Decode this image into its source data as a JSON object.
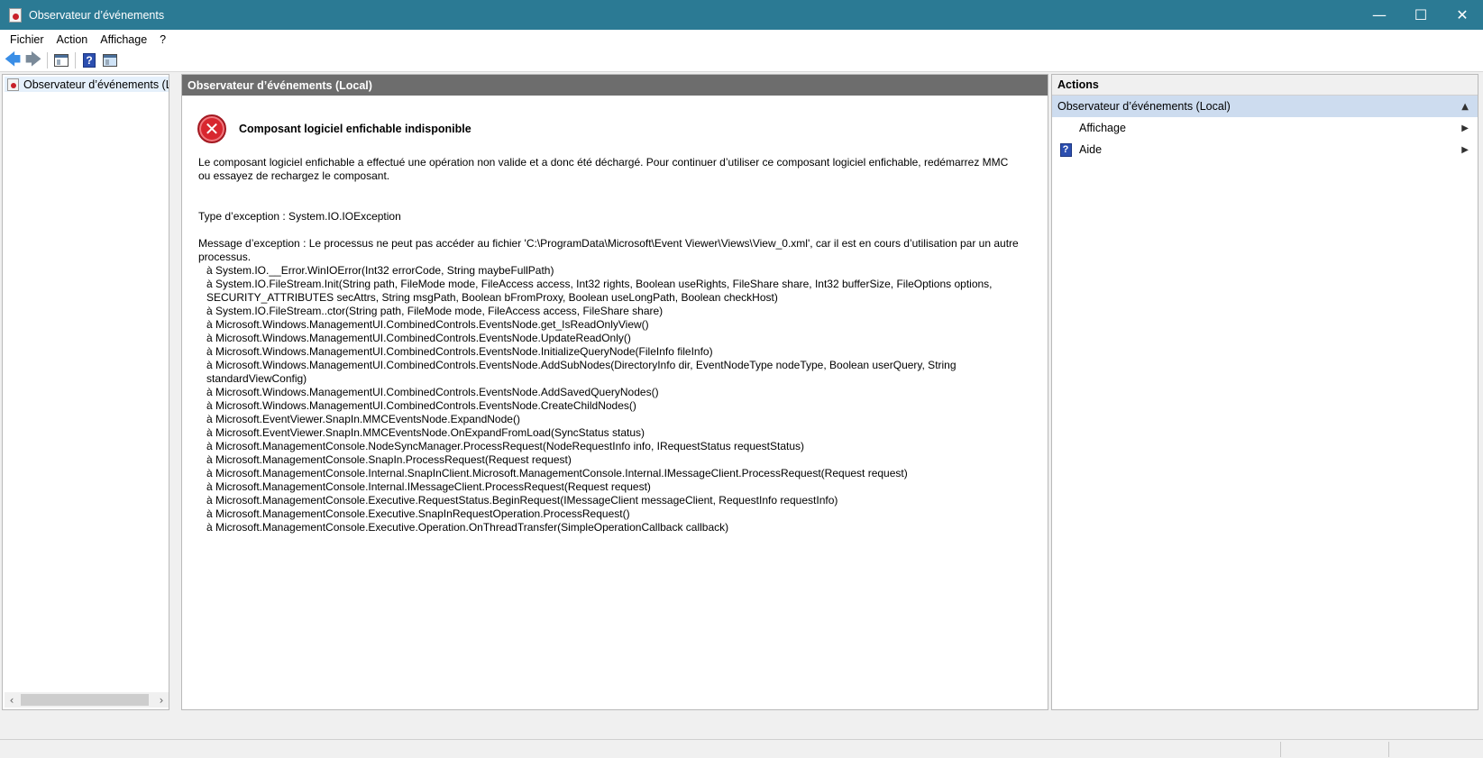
{
  "window": {
    "title": "Observateur d’événements",
    "minimize_glyph": "—",
    "maximize_glyph": "☐",
    "close_glyph": "✕"
  },
  "menu": {
    "items": [
      "Fichier",
      "Action",
      "Affichage",
      "?"
    ]
  },
  "toolbar": {
    "back_glyph": "🡄",
    "forward_glyph": "🡆",
    "help_glyph": "?"
  },
  "tree": {
    "root_label": "Observateur d’événements (Local)",
    "scroll_left": "‹",
    "scroll_right": "›"
  },
  "center": {
    "header": "Observateur d’événements (Local)",
    "error_glyph": "✕",
    "error_title": "Composant logiciel enfichable indisponible",
    "description": "Le composant logiciel enfichable a effectué une opération non valide et a donc été déchargé. Pour continuer d’utiliser ce composant logiciel enfichable, redémarrez MMC ou essayez de rechargez le composant.",
    "exception_type": "Type d’exception : System.IO.IOException",
    "exception_message": "Message d’exception : Le processus ne peut pas accéder au fichier 'C:\\ProgramData\\Microsoft\\Event Viewer\\Views\\View_0.xml', car il est en cours d’utilisation par un autre processus.",
    "stack_trace": [
      "à System.IO.__Error.WinIOError(Int32 errorCode, String maybeFullPath)",
      "à System.IO.FileStream.Init(String path, FileMode mode, FileAccess access, Int32 rights, Boolean useRights, FileShare share, Int32 bufferSize, FileOptions options, SECURITY_ATTRIBUTES secAttrs, String msgPath, Boolean bFromProxy, Boolean useLongPath, Boolean checkHost)",
      "à System.IO.FileStream..ctor(String path, FileMode mode, FileAccess access, FileShare share)",
      "à Microsoft.Windows.ManagementUI.CombinedControls.EventsNode.get_IsReadOnlyView()",
      "à Microsoft.Windows.ManagementUI.CombinedControls.EventsNode.UpdateReadOnly()",
      "à Microsoft.Windows.ManagementUI.CombinedControls.EventsNode.InitializeQueryNode(FileInfo fileInfo)",
      "à Microsoft.Windows.ManagementUI.CombinedControls.EventsNode.AddSubNodes(DirectoryInfo dir, EventNodeType nodeType, Boolean userQuery, String standardViewConfig)",
      "à Microsoft.Windows.ManagementUI.CombinedControls.EventsNode.AddSavedQueryNodes()",
      "à Microsoft.Windows.ManagementUI.CombinedControls.EventsNode.CreateChildNodes()",
      "à Microsoft.EventViewer.SnapIn.MMCEventsNode.ExpandNode()",
      "à Microsoft.EventViewer.SnapIn.MMCEventsNode.OnExpandFromLoad(SyncStatus status)",
      "à Microsoft.ManagementConsole.NodeSyncManager.ProcessRequest(NodeRequestInfo info, IRequestStatus requestStatus)",
      "à Microsoft.ManagementConsole.SnapIn.ProcessRequest(Request request)",
      "à Microsoft.ManagementConsole.Internal.SnapInClient.Microsoft.ManagementConsole.Internal.IMessageClient.ProcessRequest(Request request)",
      "à Microsoft.ManagementConsole.Internal.IMessageClient.ProcessRequest(Request request)",
      "à Microsoft.ManagementConsole.Executive.RequestStatus.BeginRequest(IMessageClient messageClient, RequestInfo requestInfo)",
      "à Microsoft.ManagementConsole.Executive.SnapInRequestOperation.ProcessRequest()",
      "à Microsoft.ManagementConsole.Executive.Operation.OnThreadTransfer(SimpleOperationCallback callback)"
    ]
  },
  "actions": {
    "header": "Actions",
    "section_label": "Observateur d’événements (Local)",
    "collapse_glyph": "▲",
    "items": [
      {
        "label": "Affichage",
        "icon": "none",
        "submenu_glyph": "▶"
      },
      {
        "label": "Aide",
        "icon": "help-icon",
        "submenu_glyph": "▶"
      }
    ],
    "help_glyph": "?"
  }
}
